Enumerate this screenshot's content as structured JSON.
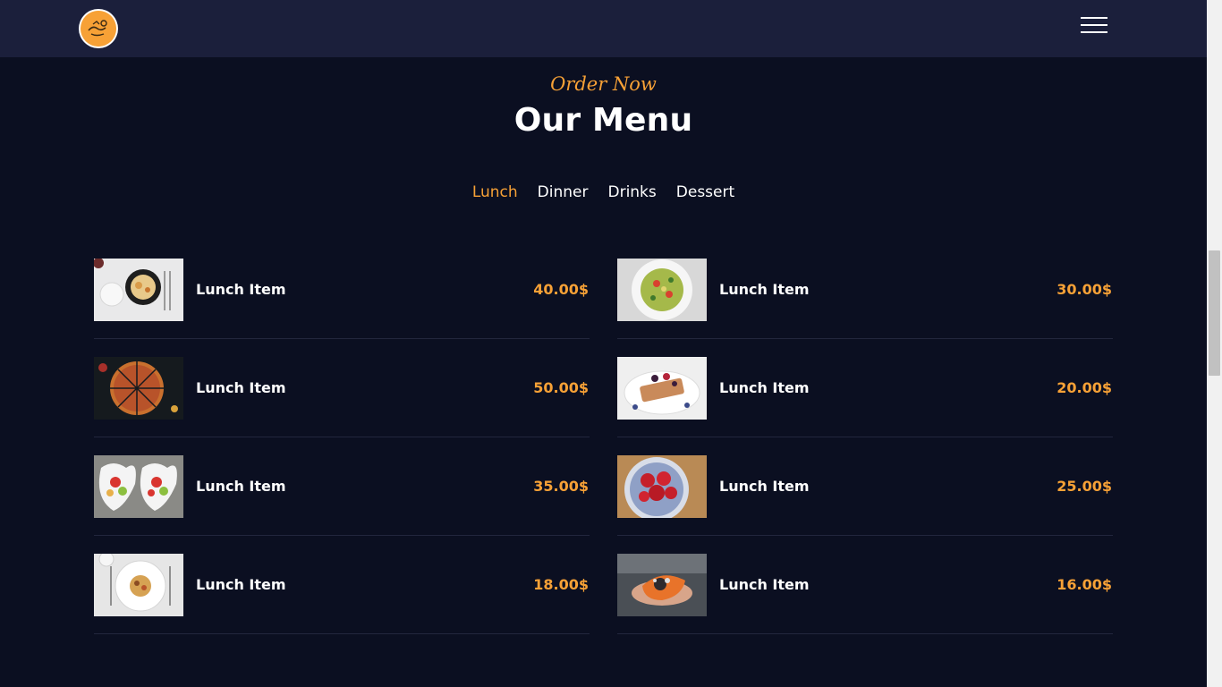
{
  "header": {
    "logo_icon": "chef-logo-icon",
    "menu_icon": "hamburger-menu-icon",
    "accent_color": "#f7a136",
    "background_color": "#1b1f3b"
  },
  "section": {
    "eyebrow": "Order Now",
    "title": "Our Menu"
  },
  "tabs": [
    {
      "label": "Lunch",
      "active": true
    },
    {
      "label": "Dinner",
      "active": false
    },
    {
      "label": "Drinks",
      "active": false
    },
    {
      "label": "Dessert",
      "active": false
    }
  ],
  "items": [
    {
      "name": "Lunch Item",
      "price": "40.00$",
      "image": "pasta-skillet-image"
    },
    {
      "name": "Lunch Item",
      "price": "30.00$",
      "image": "salad-plate-image"
    },
    {
      "name": "Lunch Item",
      "price": "50.00$",
      "image": "pizza-image"
    },
    {
      "name": "Lunch Item",
      "price": "20.00$",
      "image": "waffles-berries-image"
    },
    {
      "name": "Lunch Item",
      "price": "35.00$",
      "image": "fruit-bowls-image"
    },
    {
      "name": "Lunch Item",
      "price": "25.00$",
      "image": "strawberries-plate-image"
    },
    {
      "name": "Lunch Item",
      "price": "18.00$",
      "image": "pasta-plate-image"
    },
    {
      "name": "Lunch Item",
      "price": "16.00$",
      "image": "papaya-hands-image"
    }
  ]
}
